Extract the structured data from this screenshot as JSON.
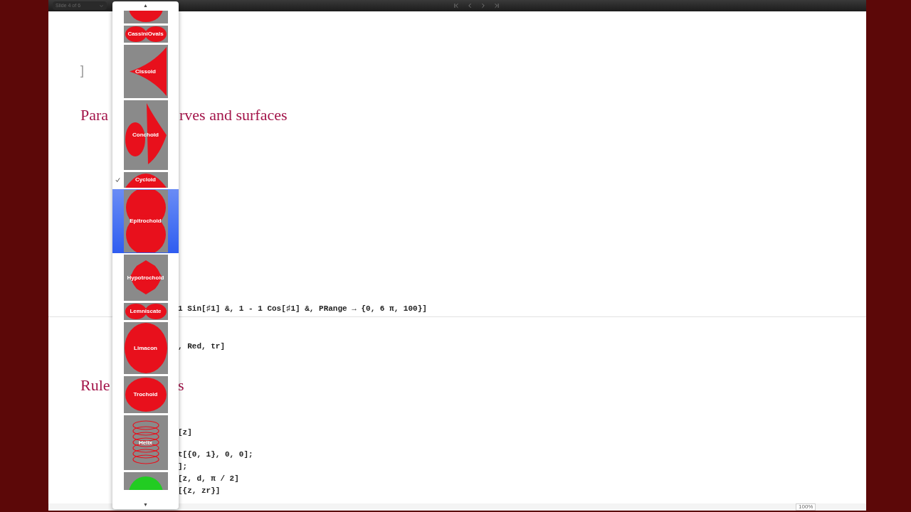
{
  "toolbar": {
    "slide_selector": "Slide 4 of 6"
  },
  "document": {
    "bracket": "]",
    "heading_1": {
      "left": "Para",
      "right": "rves and surfaces"
    },
    "code_1": "1 Sin[♯1] &, 1 - 1 Cos[♯1] &, PRange → {0, 6 π, 100}]",
    "code_2": ", Red, tr]",
    "heading_2": {
      "left": "Rule",
      "right": "s"
    },
    "code_lines": [
      "[z]",
      "t[{0, 1}, 0, 0];",
      "];",
      "[z, d, π / 2]",
      "[{z, zr}]"
    ]
  },
  "zoom": "100%",
  "menu": {
    "scroll_up": "▲",
    "scroll_down": "▼",
    "items": [
      {
        "kind": "blob",
        "selected": false,
        "checked": false
      },
      {
        "kind": "cassini",
        "label": "CassiniOvals",
        "selected": false,
        "checked": false
      },
      {
        "kind": "cissoid",
        "label": "Cissoid",
        "selected": false,
        "checked": false
      },
      {
        "kind": "conchoid",
        "label": "Conchoid",
        "selected": false,
        "checked": false
      },
      {
        "kind": "cycloid",
        "label": "Cycloid",
        "selected": false,
        "checked": true
      },
      {
        "kind": "epitrochoid",
        "label": "Epitrochoid",
        "selected": true,
        "checked": false
      },
      {
        "kind": "hypotrochoid",
        "label": "Hypotrochoid",
        "selected": false,
        "checked": false
      },
      {
        "kind": "lemniscate",
        "label": "Lemniscate",
        "selected": false,
        "checked": false
      },
      {
        "kind": "limacon",
        "label": "Limacon",
        "selected": false,
        "checked": false
      },
      {
        "kind": "trochoid",
        "label": "Trochoid",
        "selected": false,
        "checked": false
      },
      {
        "kind": "helix",
        "label": "Helix",
        "selected": false,
        "checked": false
      },
      {
        "kind": "sphere",
        "selected": false,
        "checked": false
      }
    ]
  }
}
